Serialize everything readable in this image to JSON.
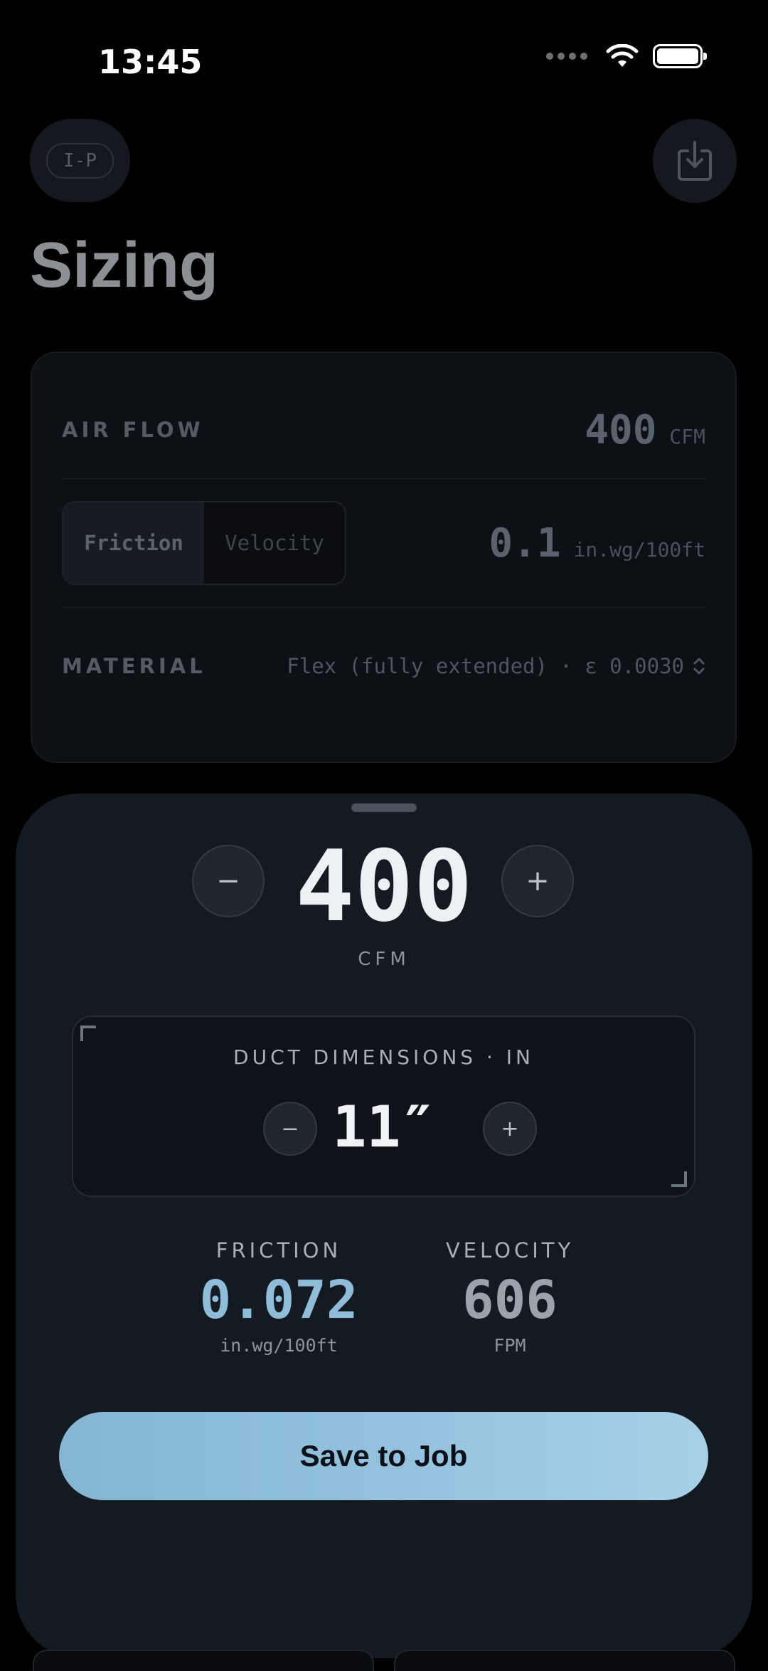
{
  "status_bar": {
    "time": "13:45"
  },
  "header": {
    "unit_system": "I-P",
    "title": "Sizing"
  },
  "inputs": {
    "airflow": {
      "label": "AIR FLOW",
      "value": "400",
      "unit": "CFM"
    },
    "mode": {
      "options": [
        "Friction",
        "Velocity"
      ],
      "selected": "Friction",
      "value": "0.1",
      "unit": "in.wg/100ft"
    },
    "material": {
      "label": "MATERIAL",
      "value": "Flex (fully extended) · ε 0.0030"
    }
  },
  "sheet": {
    "cfm": {
      "minus": "−",
      "value": "400",
      "plus": "+",
      "unit": "CFM"
    },
    "duct": {
      "title": "DUCT DIMENSIONS · IN",
      "minus": "−",
      "value": "11″",
      "plus": "+"
    },
    "results": {
      "friction": {
        "label": "FRICTION",
        "value": "0.072",
        "unit": "in.wg/100ft"
      },
      "velocity": {
        "label": "VELOCITY",
        "value": "606",
        "unit": "FPM"
      }
    },
    "save_label": "Save to Job"
  },
  "colors": {
    "accent": "#8fbcd9",
    "background": "#000000",
    "sheet": "#141a21"
  }
}
